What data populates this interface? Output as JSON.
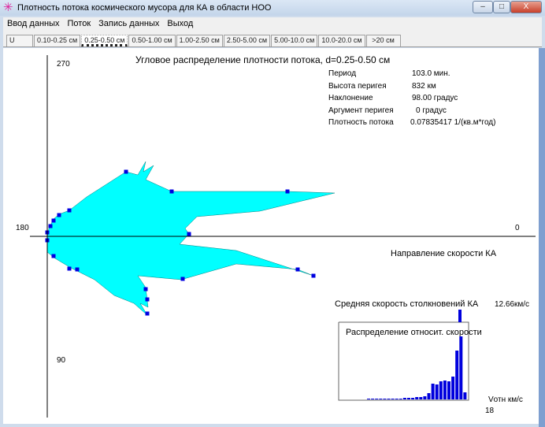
{
  "window": {
    "title": "Плотность потока космического мусора для КА в области НОО",
    "buttons": {
      "minimize": "–",
      "maximize": "□",
      "close": "X"
    }
  },
  "menu": [
    "Ввод данных",
    "Поток",
    "Запись данных",
    "Выход"
  ],
  "tabs": [
    "U",
    "0.10-0.25 см",
    "0.25-0.50 см",
    "0.50-1.00 см",
    "1.00-2.50 см",
    "2.50-5.00 см",
    "5.00-10.0 см",
    "10.0-20.0 см",
    ">20 см"
  ],
  "active_tab": 2,
  "plot": {
    "title": "Угловое распределение плотности потока, d=0.25-0.50 см",
    "angle_labels": {
      "top": "270",
      "left": "180",
      "right": "0",
      "bottom": "90"
    },
    "velocity_axis_label": "Направление скорости КА"
  },
  "params": [
    {
      "label": "Период",
      "value": "103.0 мин."
    },
    {
      "label": "Высота перигея",
      "value": "832 км"
    },
    {
      "label": "Наклонение",
      "value": "98.00 градус"
    },
    {
      "label": "Аргумент перигея",
      "value": "0 градус"
    },
    {
      "label": "Плотность потока",
      "value": "0.07835417 1/(кв.м*год)"
    }
  ],
  "histogram": {
    "mean_label": "Средняя скорость столкновений КА",
    "mean_value": "12.66км/с",
    "title": "Распределение относит. скорости",
    "xlabel": "Vотн км/с",
    "xmax_label": "18"
  },
  "colors": {
    "fill": "#00ffff",
    "marker": "#0000e0",
    "bars": "#0000dd"
  },
  "chart_data": [
    {
      "type": "polar-area",
      "title": "Угловое распределение плотности потока, d=0.25-0.50 см",
      "units": "relative (x along velocity, y toward 270)",
      "outline": [
        [
          0,
          0
        ],
        [
          0.02,
          0.1
        ],
        [
          0.08,
          0.22
        ],
        [
          0.15,
          0.28
        ],
        [
          0.28,
          0.33
        ],
        [
          0.5,
          0.5
        ],
        [
          1.0,
          0.82
        ],
        [
          1.15,
          0.78
        ],
        [
          1.25,
          0.95
        ],
        [
          1.22,
          0.82
        ],
        [
          1.35,
          0.9
        ],
        [
          1.25,
          0.72
        ],
        [
          1.58,
          0.57
        ],
        [
          3.05,
          0.57
        ],
        [
          3.65,
          0.55
        ],
        [
          2.7,
          0.32
        ],
        [
          1.9,
          0.25
        ],
        [
          1.75,
          0.1
        ],
        [
          1.8,
          0.03
        ],
        [
          1.68,
          -0.1
        ],
        [
          2.4,
          -0.18
        ],
        [
          3.38,
          -0.5
        ],
        [
          3.18,
          -0.42
        ],
        [
          2.4,
          -0.35
        ],
        [
          1.7,
          -0.55
        ],
        [
          1.15,
          -0.5
        ],
        [
          1.25,
          -0.65
        ],
        [
          1.28,
          -0.9
        ],
        [
          1.18,
          -0.85
        ],
        [
          1.27,
          -1.0
        ],
        [
          1.1,
          -0.85
        ],
        [
          0.85,
          -0.75
        ],
        [
          0.6,
          -0.55
        ],
        [
          0.4,
          -0.45
        ],
        [
          0.3,
          -0.4
        ],
        [
          0.1,
          -0.28
        ],
        [
          0,
          -0.2
        ]
      ],
      "markers": [
        [
          1.0,
          0.82
        ],
        [
          1.58,
          0.57
        ],
        [
          3.05,
          0.57
        ],
        [
          0.28,
          0.33
        ],
        [
          0.15,
          0.27
        ],
        [
          0.08,
          0.2
        ],
        [
          0.04,
          0.13
        ],
        [
          0,
          0.05
        ],
        [
          1.8,
          0.03
        ],
        [
          0,
          -0.05
        ],
        [
          0.08,
          -0.25
        ],
        [
          0.28,
          -0.41
        ],
        [
          0.38,
          -0.42
        ],
        [
          1.72,
          -0.54
        ],
        [
          3.18,
          -0.42
        ],
        [
          3.38,
          -0.5
        ],
        [
          1.25,
          -0.67
        ],
        [
          1.27,
          -0.8
        ],
        [
          1.27,
          -0.98
        ]
      ]
    },
    {
      "type": "bar",
      "title": "Распределение относит. скорости",
      "xlabel": "Vотн км/с",
      "xlim": [
        0,
        18
      ],
      "values": [
        1,
        1,
        1,
        0,
        0,
        1,
        1,
        1,
        1,
        2,
        2,
        2,
        3,
        3,
        4,
        8,
        20,
        19,
        23,
        24,
        23,
        29,
        62,
        80,
        9
      ],
      "mean": 12.66
    }
  ]
}
